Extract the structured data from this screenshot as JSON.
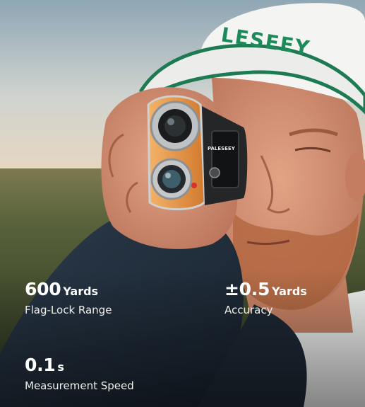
{
  "photo": {
    "cap_brand": "LESEEY",
    "device_brand": "PALESEEY"
  },
  "stats": [
    {
      "value": "600",
      "unit": "Yards",
      "label": "Flag-Lock Range"
    },
    {
      "value": "±0.5",
      "unit": "Yards",
      "label": "Accuracy"
    },
    {
      "value": "0.1",
      "unit": "s",
      "label": "Measurement Speed"
    }
  ]
}
